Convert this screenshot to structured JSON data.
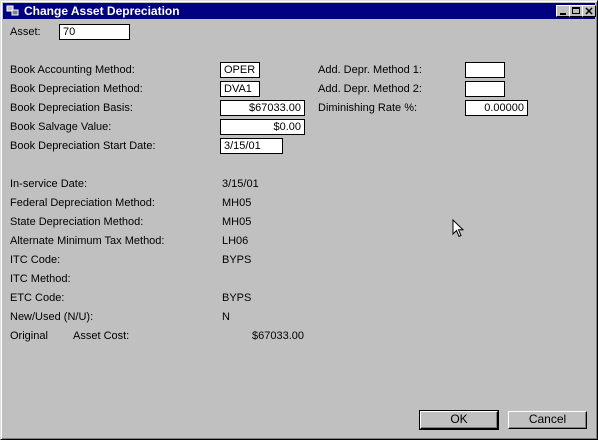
{
  "window": {
    "title": "Change Asset Depreciation"
  },
  "asset": {
    "label": "Asset:",
    "value": "70"
  },
  "book": {
    "accounting_method_label": "Book Accounting Method:",
    "accounting_method_value": "OPER",
    "depreciation_method_label": "Book Depreciation Method:",
    "depreciation_method_value": "DVA1",
    "depreciation_basis_label": "Book Depreciation Basis:",
    "depreciation_basis_value": "$67033.00",
    "salvage_value_label": "Book Salvage Value:",
    "salvage_value_value": "$0.00",
    "start_date_label": "Book Depreciation Start Date:",
    "start_date_value": "3/15/01"
  },
  "additional": {
    "method1_label": "Add. Depr. Method 1:",
    "method1_value": "",
    "method2_label": "Add. Depr. Method 2:",
    "method2_value": "",
    "diminishing_rate_label": "Diminishing Rate %:",
    "diminishing_rate_value": "0.00000"
  },
  "info": {
    "in_service_label": "In-service Date:",
    "in_service_value": "3/15/01",
    "federal_label": "Federal Depreciation Method:",
    "federal_value": "MH05",
    "state_label": "State Depreciation Method:",
    "state_value": "MH05",
    "amt_label": "Alternate Minimum Tax Method:",
    "amt_value": "LH06",
    "itc_code_label": "ITC Code:",
    "itc_code_value": "BYPS",
    "itc_method_label": "ITC Method:",
    "itc_method_value": "",
    "etc_code_label": "ETC Code:",
    "etc_code_value": "BYPS",
    "new_used_label": "New/Used (N/U):",
    "new_used_value": "N",
    "original_label": "Original",
    "asset_cost_label": "Asset Cost:",
    "asset_cost_value": "$67033.00"
  },
  "buttons": {
    "ok": "OK",
    "cancel": "Cancel"
  },
  "icons": {
    "system": "app-icon",
    "minimize": "minimize-icon",
    "maximize": "maximize-icon",
    "close": "close-icon",
    "cursor": "mouse-pointer-icon"
  },
  "colors": {
    "titlebar": "#000080",
    "face": "#c0c0c0"
  }
}
